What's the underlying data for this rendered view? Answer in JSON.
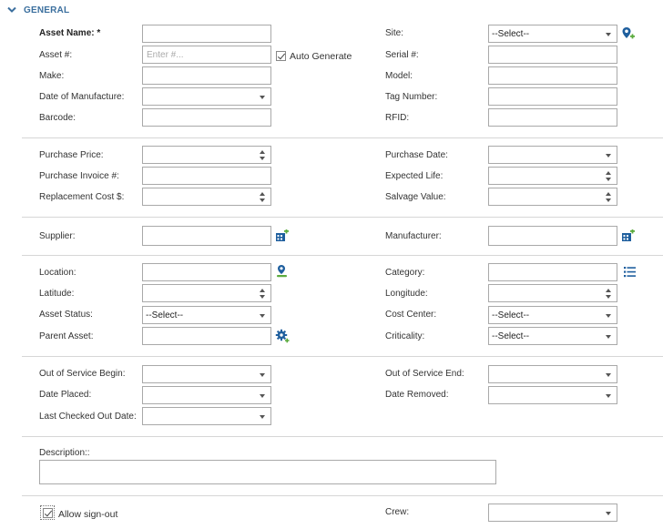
{
  "section": {
    "title": "GENERAL"
  },
  "labels": {
    "asset_name": "Asset Name: *",
    "asset_no": "Asset #:",
    "make": "Make:",
    "date_of_manufacture": "Date of Manufacture:",
    "barcode": "Barcode:",
    "site": "Site:",
    "serial_no": "Serial #:",
    "model": "Model:",
    "tag_number": "Tag Number:",
    "rfid": "RFID:",
    "purchase_price": "Purchase Price:",
    "purchase_invoice": "Purchase Invoice #:",
    "replacement_cost": "Replacement Cost $:",
    "purchase_date": "Purchase Date:",
    "expected_life": "Expected Life:",
    "salvage_value": "Salvage Value:",
    "supplier": "Supplier:",
    "manufacturer": "Manufacturer:",
    "location": "Location:",
    "latitude": "Latitude:",
    "asset_status": "Asset Status:",
    "parent_asset": "Parent Asset:",
    "category": "Category:",
    "longitude": "Longitude:",
    "cost_center": "Cost Center:",
    "criticality": "Criticality:",
    "out_of_service_begin": "Out of Service Begin:",
    "date_placed": "Date Placed:",
    "last_checked_out_date": "Last Checked Out Date:",
    "out_of_service_end": "Out of Service End:",
    "date_removed": "Date Removed:",
    "description": "Description::",
    "crew": "Crew:"
  },
  "fields": {
    "asset_no_placeholder": "Enter #...",
    "auto_generate_label": "Auto Generate",
    "auto_generate_checked": true,
    "site_value": "--Select--",
    "asset_status_value": "--Select--",
    "cost_center_value": "--Select--",
    "criticality_value": "--Select--",
    "allow_sign_out_label": "Allow sign-out",
    "allow_sign_out_checked": true
  },
  "icons": {
    "site": "map-pin-add-icon",
    "supplier": "building-add-icon",
    "manufacturer": "building-add-icon",
    "location": "map-pin-user-icon",
    "category": "list-icon",
    "parent_asset": "gear-icon",
    "collapse": "chevron-down-icon"
  },
  "colors": {
    "accent": "#3b6f9e",
    "icon_blue": "#1f5f9e",
    "icon_green": "#5cab3f"
  }
}
